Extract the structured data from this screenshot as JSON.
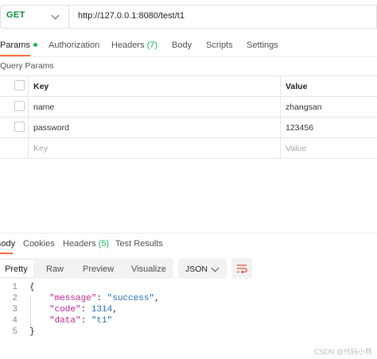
{
  "request": {
    "method": "GET",
    "url": "http://127.0.0.1:8080/test/t1"
  },
  "request_tabs": [
    {
      "label": "Params"
    },
    {
      "label": "Authorization"
    },
    {
      "label": "Headers",
      "count": "(7)"
    },
    {
      "label": "Body"
    },
    {
      "label": "Scripts"
    },
    {
      "label": "Settings"
    }
  ],
  "query_params": {
    "section_label": "Query Params",
    "headers": {
      "key": "Key",
      "value": "Value"
    },
    "rows": [
      {
        "key": "name",
        "value": "zhangsan"
      },
      {
        "key": "password",
        "value": "123456"
      }
    ],
    "placeholder": {
      "key": "Key",
      "value": "Value"
    }
  },
  "response_tabs": [
    {
      "label": "Body"
    },
    {
      "label": "Cookies"
    },
    {
      "label": "Headers",
      "count": "(5)"
    },
    {
      "label": "Test Results"
    }
  ],
  "view_modes": [
    "Pretty",
    "Raw",
    "Preview",
    "Visualize"
  ],
  "format": "JSON",
  "response_body": {
    "line_numbers": [
      "1",
      "2",
      "3",
      "4",
      "5"
    ],
    "open_brace": "{",
    "close_brace": "}",
    "fields": [
      {
        "key": "\"message\"",
        "value": "\"success\"",
        "comma": ","
      },
      {
        "key": "\"code\"",
        "value": "1314",
        "comma": ","
      },
      {
        "key": "\"data\"",
        "value": "\"t1\"",
        "comma": ""
      }
    ]
  },
  "watermark": "CSDN @代码小熊"
}
